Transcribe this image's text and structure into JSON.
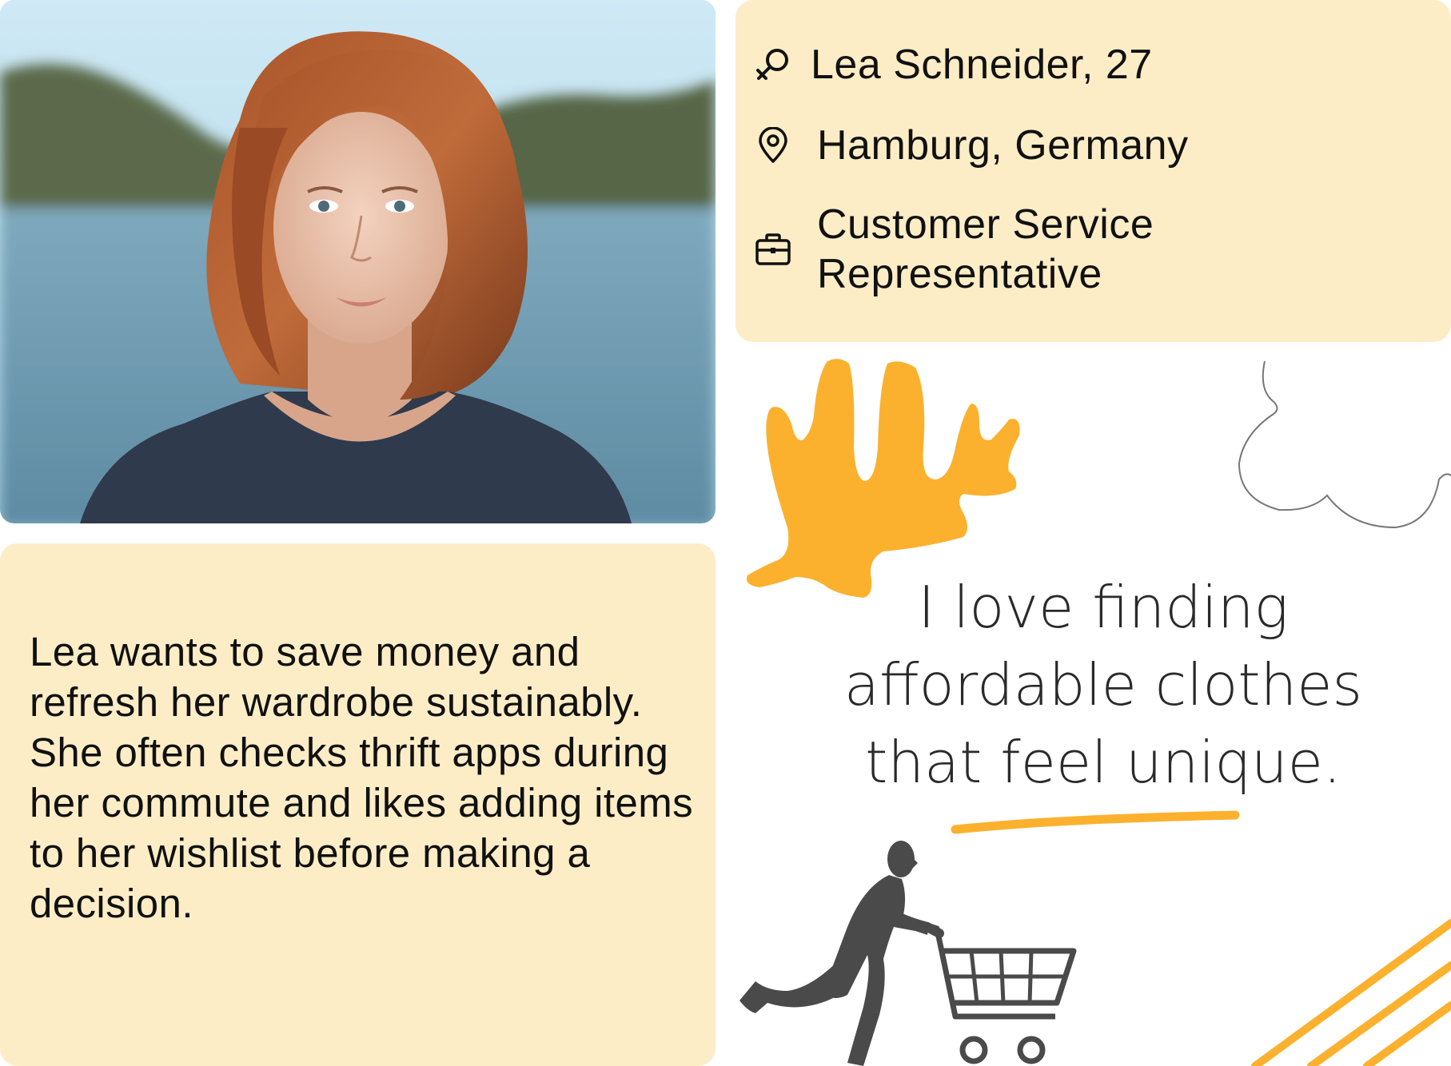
{
  "profile": {
    "name_age": "Lea Schneider, 27",
    "location": "Hamburg, Germany",
    "occupation": "Customer Service Representative"
  },
  "icons": {
    "gender": "female-gender-icon",
    "location": "map-pin-icon",
    "occupation": "briefcase-icon",
    "shopper": "shopper-with-cart-icon"
  },
  "description": "Lea wants to save money and refresh her wardrobe sustainably. She often checks thrift apps during her commute and likes adding items to her wishlist before making a decision.",
  "quote": "I love finding affordable clothes that feel unique.",
  "colors": {
    "card_background": "#fdedc6",
    "accent": "#fbb12e",
    "text": "#111111",
    "silhouette": "#4a4a4a"
  }
}
